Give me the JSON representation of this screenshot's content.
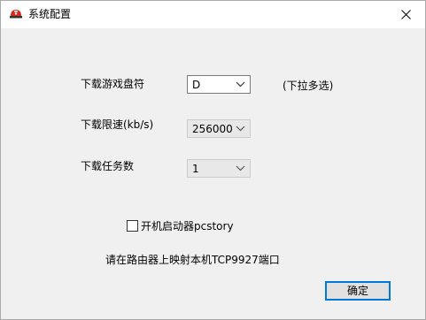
{
  "window": {
    "title": "系统配置",
    "icon": "red-helmet-app-icon",
    "close_icon": "close-icon"
  },
  "fields": {
    "game_drive": {
      "label": "下载游戏盘符",
      "value": "D",
      "note": "(下拉多选)",
      "enabled": true
    },
    "speed_limit": {
      "label": "下载限速(kb/s)",
      "value": "256000",
      "enabled": false
    },
    "task_count": {
      "label": "下载任务数",
      "value": "1",
      "enabled": false
    }
  },
  "autostart": {
    "label": "开机启动器pcstory",
    "checked": false
  },
  "hint": "请在路由器上映射本机TCP9927端口",
  "ok_label": "确定",
  "colors": {
    "client_bg": "#f0f0f0",
    "accent": "#0078d7",
    "disabled_bg": "#e8e8e8"
  }
}
